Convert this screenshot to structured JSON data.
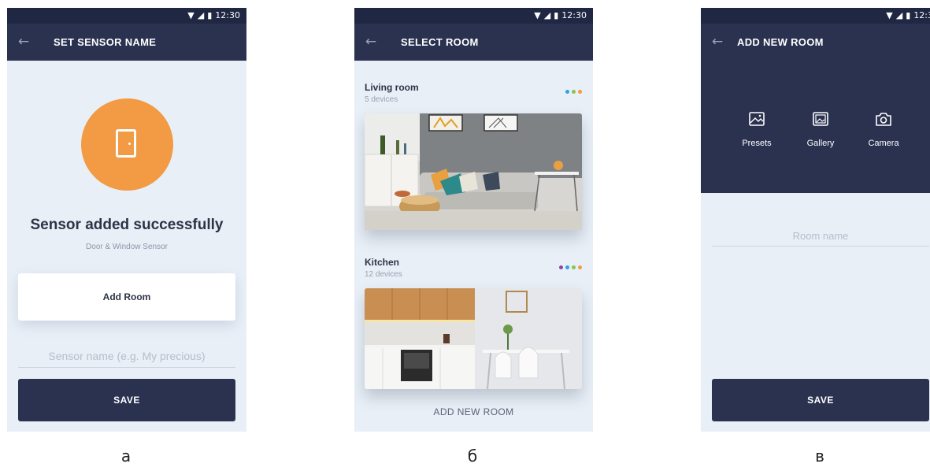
{
  "screens": {
    "a": {
      "status_time": "12:30",
      "title": "SET SENSOR NAME",
      "heading": "Sensor added successfully",
      "subheading": "Door & Window Sensor",
      "add_room_label": "Add Room",
      "name_placeholder": "Sensor name (e.g. My precious)",
      "save_label": "SAVE",
      "icon": "door-icon",
      "accent": "#f29a44"
    },
    "b": {
      "status_time": "12:30",
      "title": "SELECT ROOM",
      "rooms": [
        {
          "name": "Living room",
          "devices": "5 devices",
          "dot_colors": [
            "#2ea4dc",
            "#8bc34a",
            "#f29a44"
          ]
        },
        {
          "name": "Kitchen",
          "devices": "12 devices",
          "dot_colors": [
            "#8e44ad",
            "#2ea4dc",
            "#8bc34a",
            "#f29a44"
          ]
        }
      ],
      "add_new_room_label": "ADD NEW ROOM"
    },
    "c": {
      "status_time": "12:3",
      "title": "ADD NEW ROOM",
      "options": [
        {
          "label": "Presets",
          "icon": "image-icon"
        },
        {
          "label": "Gallery",
          "icon": "gallery-icon"
        },
        {
          "label": "Camera",
          "icon": "camera-icon"
        }
      ],
      "room_name_placeholder": "Room name",
      "save_label": "SAVE"
    }
  },
  "captions": [
    "а",
    "б",
    "в"
  ],
  "colors": {
    "navy": "#2a3250",
    "statusbar": "#1f2743",
    "background": "#e8eff7"
  }
}
